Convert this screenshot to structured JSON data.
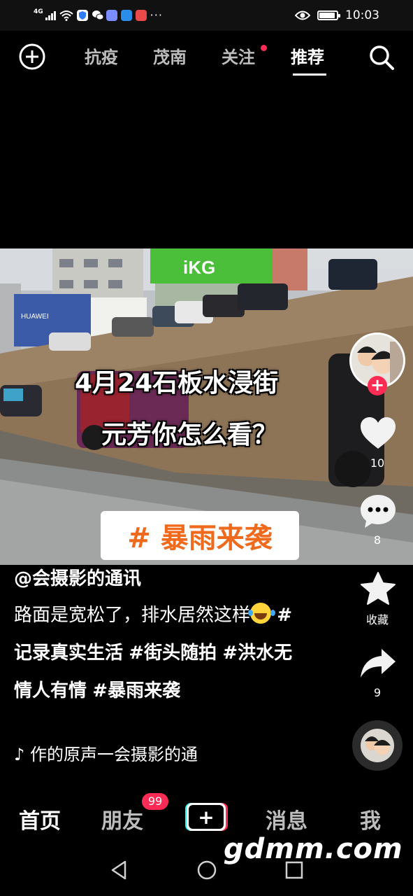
{
  "status_bar": {
    "network": "4G",
    "time": "10:03",
    "overflow": "···",
    "battery_level": 0.9,
    "icons": [
      "signal-icon",
      "wifi-icon",
      "shield-app-icon",
      "wechat-icon",
      "music-app-icon",
      "weather-app-icon",
      "news-app-icon",
      "eye-comfort-icon",
      "battery-icon"
    ]
  },
  "top_nav": {
    "tabs": [
      {
        "label": "抗疫",
        "active": false
      },
      {
        "label": "茂南",
        "active": false
      },
      {
        "label": "关注",
        "active": false,
        "has_dot": true
      },
      {
        "label": "推荐",
        "active": true
      }
    ],
    "left_icon": "add-circle-icon",
    "right_icon": "search-icon"
  },
  "video": {
    "caption_line1": "4月24石板水浸街",
    "caption_line2": "元芳你怎么看？",
    "hashtag_banner": "# 暴雨来袭",
    "storefront_sign": "iKG"
  },
  "right_rail": {
    "like_count": "10",
    "comment_count": "8",
    "favorite_label": "收藏",
    "share_count": "9",
    "follow_symbol": "+"
  },
  "post": {
    "author": "@会摄影的通讯",
    "desc_text": "路面是宽松了，排水居然这样",
    "hashtags": [
      "#记录真实生活",
      "#街头随拍",
      "#洪水无情人有情",
      "#暴雨来袭"
    ],
    "music": "作的原声一会摄影的通"
  },
  "bottom_nav": {
    "home": "首页",
    "friends": "朋友",
    "friends_badge": "99",
    "create": "+",
    "messages": "消息",
    "me": "我"
  },
  "watermark": "gdmm.com",
  "colors": {
    "accent_red": "#fe2c55",
    "hashtag_orange": "#f06a1d",
    "background": "#000000"
  }
}
